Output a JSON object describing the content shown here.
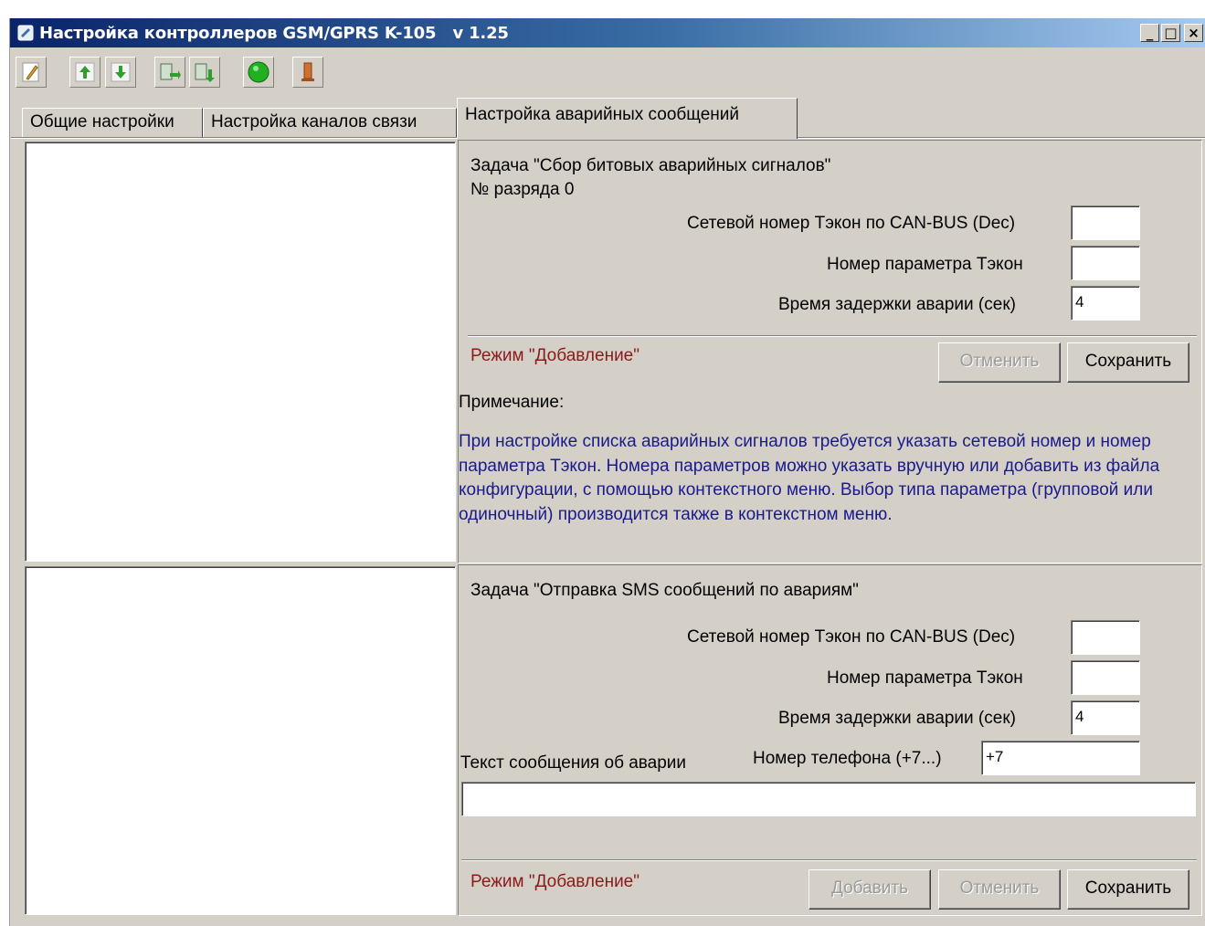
{
  "window": {
    "title": "Настройка контроллеров GSM/GPRS K-105   v 1.25",
    "minimize": "_",
    "maximize": "□",
    "close": "×"
  },
  "toolbar": {
    "buttons": [
      "edit-icon",
      "move-up-icon",
      "move-down-icon",
      "import-icon",
      "export-icon",
      "connect-icon",
      "stop-icon"
    ]
  },
  "tabs": {
    "general": "Общие настройки",
    "channels": "Настройка каналов связи",
    "alarms": "Настройка аварийных сообщений"
  },
  "section1": {
    "task": "Задача \"Сбор битовых аварийных сигналов\"",
    "bit": "№ разряда 0",
    "net_label": "Сетевой номер Тэкон по CAN-BUS  (Dec)",
    "net_value": "",
    "param_label": "Номер параметра Тэкон",
    "param_value": "",
    "delay_label": "Время задержки аварии (сек)",
    "delay_value": "4",
    "mode": "Режим \"Добавление\"",
    "cancel": "Отменить",
    "save": "Сохранить",
    "note_title": "Примечание:",
    "note_text": "При настройке списка аварийных сигналов требуется указать сетевой номер и номер параметра Тэкон. Номера параметров можно указать вручную или добавить из файла конфигурации, с помощью контекстного меню. Выбор типа параметра (групповой или одиночный) производится также в контекстном меню."
  },
  "section2": {
    "task": "Задача \"Отправка SMS сообщений по авариям\"",
    "net_label": "Сетевой номер Тэкон по CAN-BUS  (Dec)",
    "net_value": "",
    "param_label": "Номер параметра Тэкон",
    "param_value": "",
    "delay_label": "Время задержки аварии (сек)",
    "delay_value": "4",
    "msg_label": "Текст сообщения об аварии",
    "phone_label": "Номер телефона (+7...)",
    "phone_value": "+7",
    "msg_value": "",
    "mode": "Режим \"Добавление\"",
    "add": "Добавить",
    "cancel": "Отменить",
    "save": "Сохранить"
  }
}
